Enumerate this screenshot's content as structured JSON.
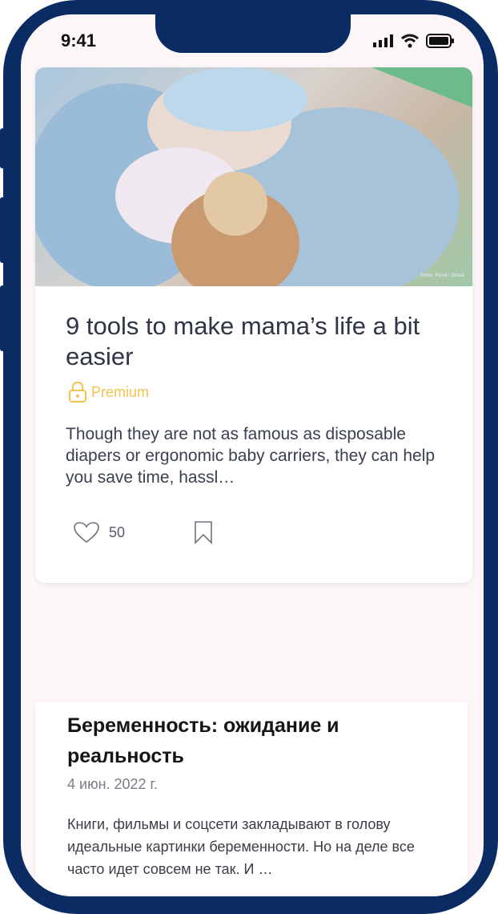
{
  "status_bar": {
    "time": "9:41"
  },
  "article": {
    "image_credit": "Photo: Pexel / iStock",
    "title": "9 tools to make mama’s life a bit easier",
    "badge": "Premium",
    "excerpt": "Though they are not as famous as disposable diapers or ergonomic baby carriers, they can help you save time, hassl…",
    "likes": "50",
    "accent_color": "#f2c44d"
  },
  "article2": {
    "title": "Беременность: ожидание и реальность",
    "date": "4 июн. 2022 г.",
    "excerpt": "Книги, фильмы и соцсети закладывают в голову идеальные картинки беременности. Но на деле все часто идет совсем не так. И …"
  },
  "colors": {
    "frame": "#0b2c63",
    "screen_bg": "#fcf6f8"
  }
}
